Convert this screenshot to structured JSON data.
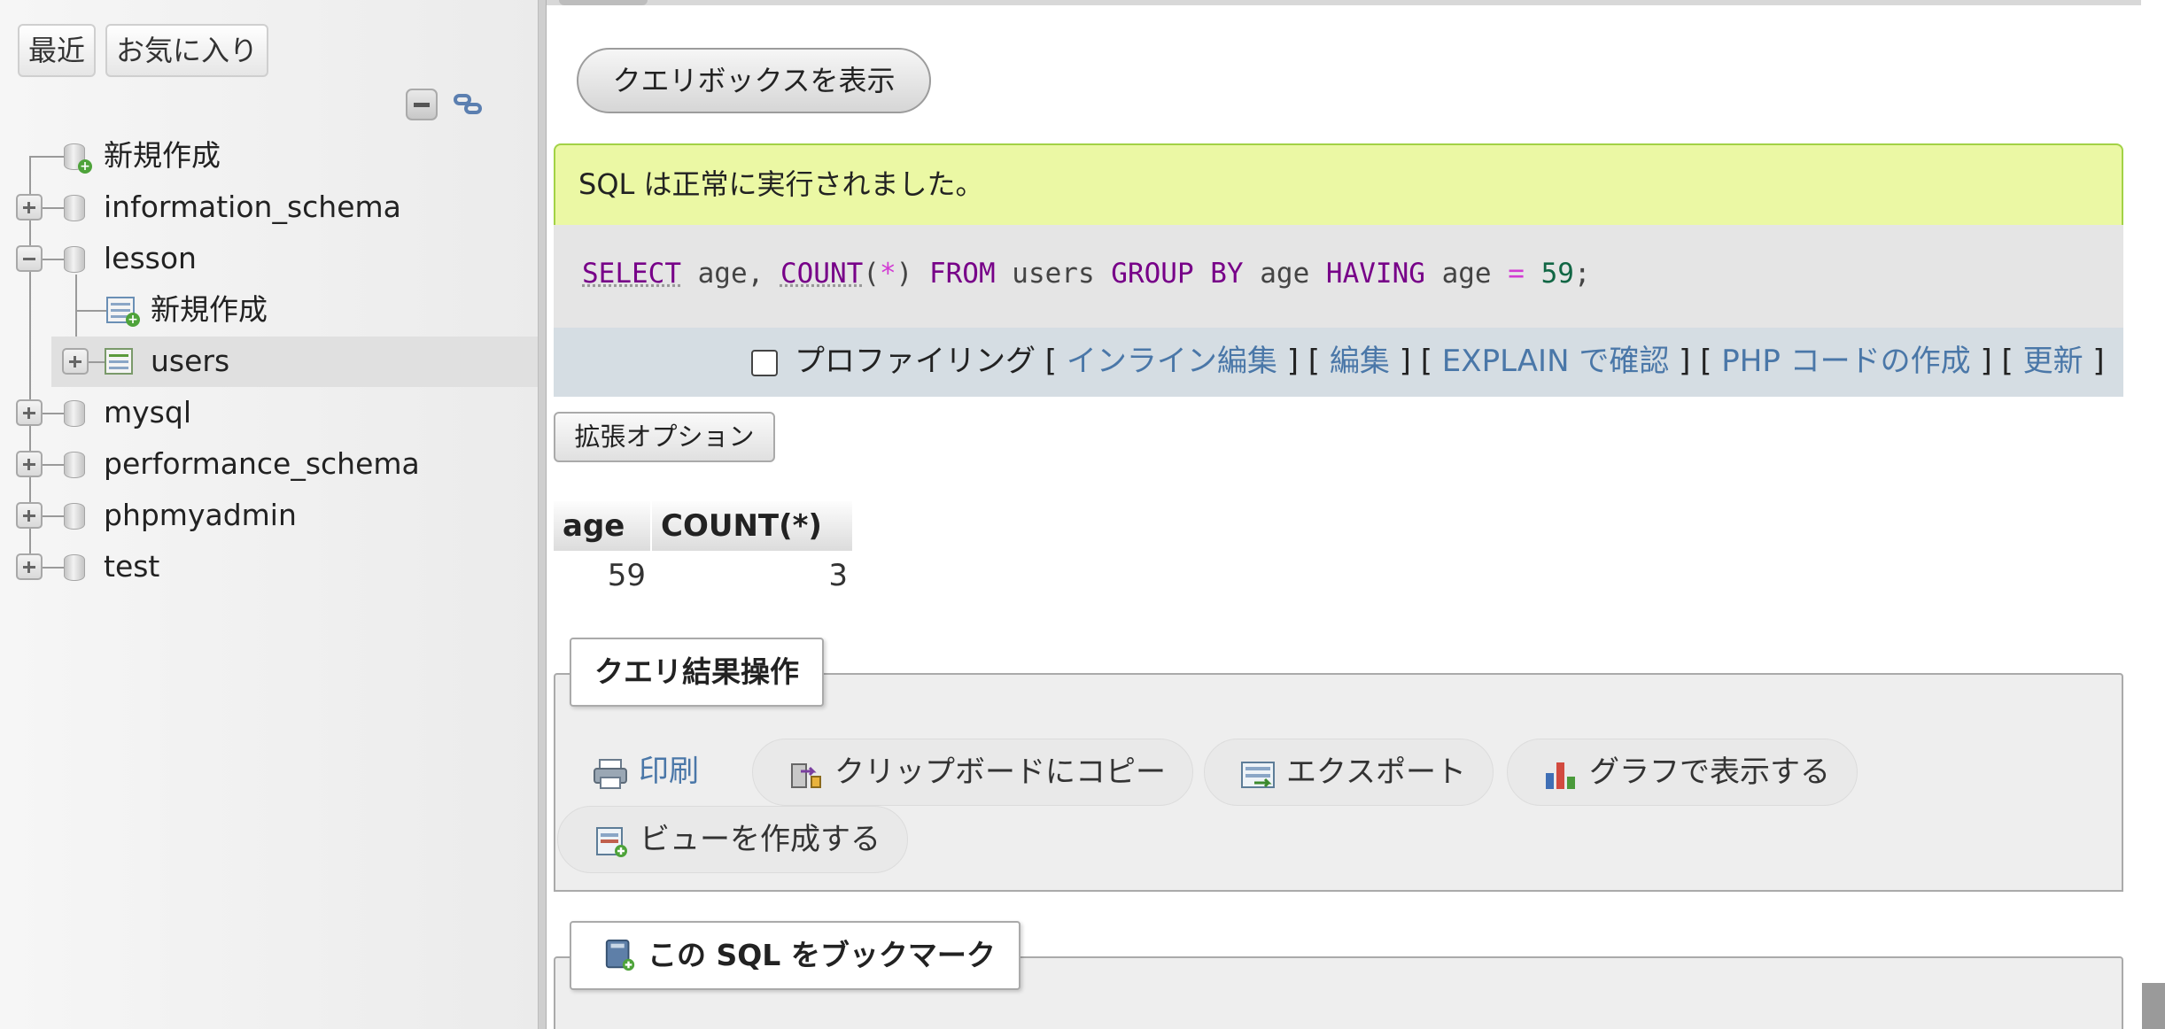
{
  "sidebar": {
    "recent_label": "最近",
    "favorites_label": "お気に入り",
    "tree": {
      "new_root": "新規作成",
      "databases": [
        "information_schema",
        "lesson",
        "mysql",
        "performance_schema",
        "phpmyadmin",
        "test"
      ],
      "lesson_children": {
        "new_table": "新規作成",
        "table_users": "users"
      }
    }
  },
  "main": {
    "show_query_box": "クエリボックスを表示",
    "success_message": "SQL は正常に実行されました。",
    "sql": {
      "select": "SELECT",
      "cols": " age, ",
      "count": "COUNT",
      "paren_open": "(",
      "star": "*",
      "paren_close": ")",
      "from": " FROM ",
      "table": "users",
      "group_by": " GROUP BY ",
      "group_col": "age",
      "having": " HAVING ",
      "having_col": "age",
      "eq": " = ",
      "value": "59",
      "semicolon": ";"
    },
    "profiling": {
      "label": "プロファイリング",
      "bracket_open": " [ ",
      "bracket_sep": " ] [ ",
      "bracket_close": " ]",
      "inline_edit": "インライン編集",
      "edit": "編集",
      "explain": "EXPLAIN で確認",
      "php_code": "PHP コードの作成",
      "refresh": "更新"
    },
    "extended_options": "拡張オプション",
    "results": {
      "headers": [
        "age",
        "COUNT(*)"
      ],
      "rows": [
        [
          "59",
          "3"
        ]
      ]
    },
    "query_ops": {
      "legend": "クエリ結果操作",
      "print": "印刷",
      "copy_clipboard": "クリップボードにコピー",
      "export": "エクスポート",
      "chart": "グラフで表示する",
      "create_view": "ビューを作成する"
    },
    "bookmark": {
      "legend": "この SQL をブックマーク"
    }
  }
}
